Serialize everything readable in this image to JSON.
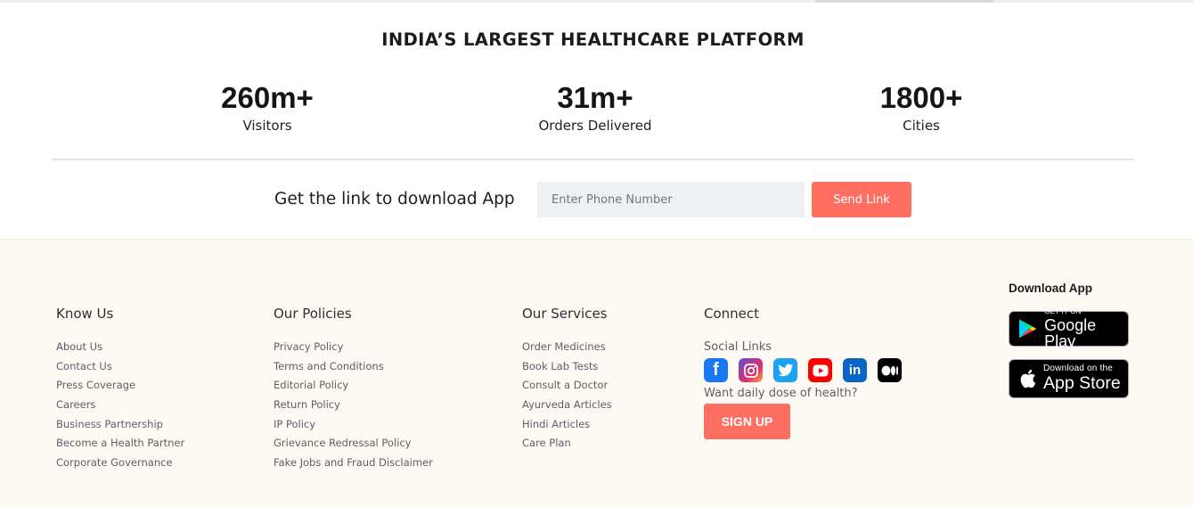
{
  "headline": "INDIA’S LARGEST HEALTHCARE PLATFORM",
  "stats": [
    {
      "value": "260m+",
      "label": "Visitors"
    },
    {
      "value": "31m+",
      "label": "Orders Delivered"
    },
    {
      "value": "1800+",
      "label": "Cities"
    }
  ],
  "app_link": {
    "label": "Get the link to download App",
    "phone_placeholder": "Enter Phone Number",
    "phone_value": "",
    "send_label": "Send Link"
  },
  "footer": {
    "know_us": {
      "title": "Know Us",
      "items": [
        "About Us",
        "Contact Us",
        "Press Coverage",
        "Careers",
        "Business Partnership",
        "Become a Health Partner",
        "Corporate Governance"
      ]
    },
    "policies": {
      "title": "Our Policies",
      "items": [
        "Privacy Policy",
        "Terms and Conditions",
        "Editorial Policy",
        "Return Policy",
        "IP Policy",
        "Grievance Redressal Policy",
        "Fake Jobs and Fraud Disclaimer"
      ]
    },
    "services": {
      "title": "Our Services",
      "items": [
        "Order Medicines",
        "Book Lab Tests",
        "Consult a Doctor",
        "Ayurveda Articles",
        "Hindi Articles",
        "Care Plan"
      ]
    },
    "connect": {
      "title": "Connect",
      "social_label": "Social Links",
      "social_icons": [
        "facebook-icon",
        "instagram-icon",
        "twitter-icon",
        "youtube-icon",
        "linkedin-icon",
        "medium-icon"
      ],
      "daily_label": "Want daily dose of health?",
      "signup_label": "SIGN UP"
    },
    "download": {
      "title": "Download App",
      "google_play": {
        "small": "GET IT ON",
        "big": "Google Play"
      },
      "app_store": {
        "small": "Download on the",
        "big": "App Store"
      }
    }
  },
  "colors": {
    "accent": "#ff6f61",
    "footer_bg": "#fdfaf4",
    "input_bg": "#eef1f4"
  }
}
